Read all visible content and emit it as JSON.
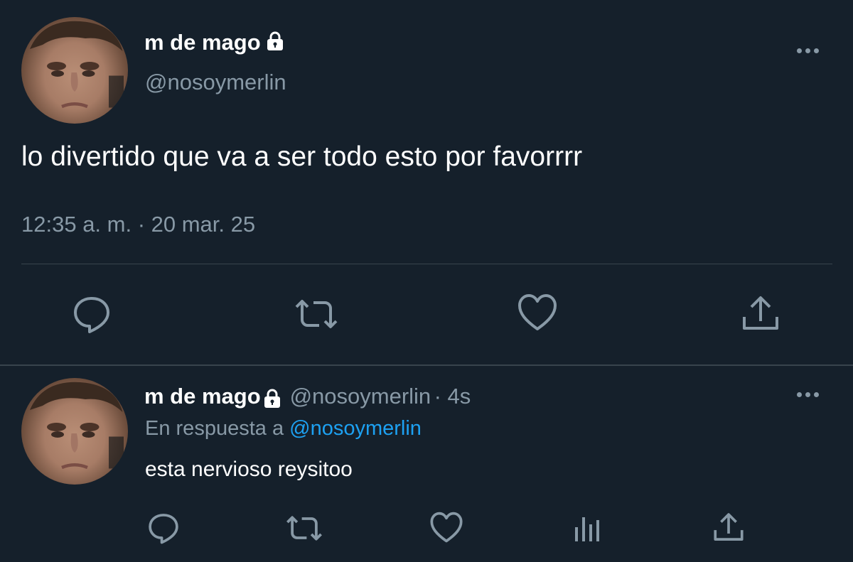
{
  "main_tweet": {
    "display_name": "m de mago",
    "handle": "@nosoymerlin",
    "text": "lo divertido que va a ser todo esto por favorrrr",
    "timestamp": "12:35 a. m. · 20 mar. 25"
  },
  "reply": {
    "display_name": "m de mago",
    "handle": "@nosoymerlin",
    "age": "· 4s",
    "reply_prefix": "En respuesta a",
    "reply_to": "@nosoymerlin",
    "text": "esta nervioso reysitoo"
  },
  "icons": {
    "actions_main": [
      "reply-icon",
      "retweet-icon",
      "like-icon",
      "share-icon"
    ],
    "actions_reply": [
      "reply-icon",
      "retweet-icon",
      "like-icon",
      "analytics-icon",
      "share-icon"
    ],
    "badge": "lock-icon",
    "menu": "more-icon"
  },
  "colors": {
    "background": "#15202b",
    "text_primary": "#ffffff",
    "text_secondary": "#8899a6",
    "link": "#1da1f2",
    "divider": "#38444d"
  }
}
